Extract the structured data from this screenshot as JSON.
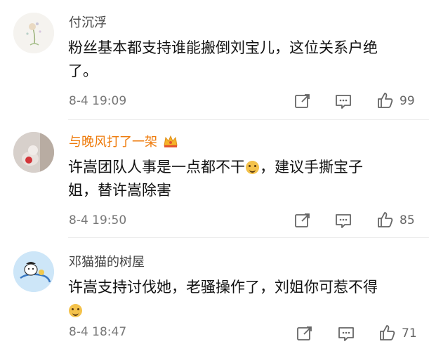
{
  "comments": [
    {
      "username": "付沉浮",
      "text_line1": "粉丝基本都支持谁能搬倒刘宝儿，这位关系户绝",
      "text_line2": "了。",
      "timestamp": "8-4 19:09",
      "like_count": "99",
      "avatar_icon": "dandelion-illustration-avatar"
    },
    {
      "username": "与晚风打了一架",
      "text_line1_before_emoji": "许嵩团队人事是一点都不干",
      "text_line1_after_emoji": "，建议手撕宝子",
      "text_line2": "姐，替许嵩除害",
      "timestamp": "8-4 19:50",
      "like_count": "85",
      "avatar_icon": "photo-avatar",
      "badge_icon": "crown-icon",
      "name_color": "#ee7a0a"
    },
    {
      "username": "邓猫猫的树屋",
      "text_line1": "许嵩支持讨伐她，老骚操作了，刘姐你可惹不得",
      "timestamp": "8-4 18:47",
      "like_count": "71",
      "avatar_icon": "cartoon-character-avatar"
    }
  ],
  "emoji_icon": "doge-emoji-icon"
}
